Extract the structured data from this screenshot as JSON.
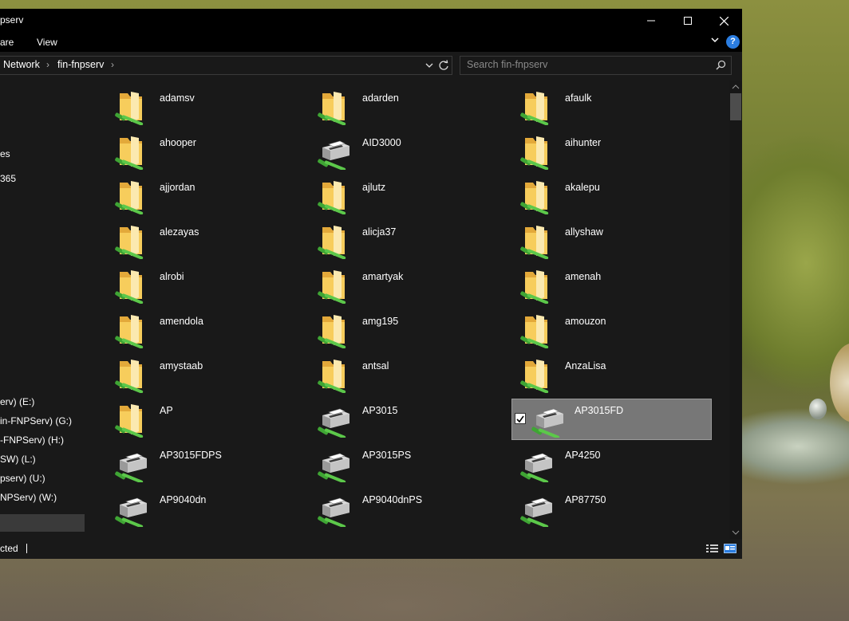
{
  "window": {
    "title": "pserv",
    "ribbon_tabs": [
      "are",
      "View"
    ],
    "help_label": "?"
  },
  "address_bar": {
    "breadcrumbs": [
      "Network",
      "fin-fnpserv"
    ],
    "separator": "›"
  },
  "search": {
    "placeholder": "Search fin-fnpserv"
  },
  "nav_pane": {
    "items": [
      "es",
      "365",
      "erv) (E:)",
      "in-FNPServ) (G:)",
      "-FNPServ) (H:)",
      "SW) (L:)",
      "pserv) (U:)",
      "NPServ) (W:)"
    ]
  },
  "items": [
    {
      "name": "adamsv",
      "type": "folder"
    },
    {
      "name": "adarden",
      "type": "folder"
    },
    {
      "name": "afaulk",
      "type": "folder"
    },
    {
      "name": "ahooper",
      "type": "folder"
    },
    {
      "name": "AID3000",
      "type": "printer"
    },
    {
      "name": "aihunter",
      "type": "folder"
    },
    {
      "name": "ajjordan",
      "type": "folder"
    },
    {
      "name": "ajlutz",
      "type": "folder"
    },
    {
      "name": "akalepu",
      "type": "folder"
    },
    {
      "name": "alezayas",
      "type": "folder"
    },
    {
      "name": "alicja37",
      "type": "folder"
    },
    {
      "name": "allyshaw",
      "type": "folder"
    },
    {
      "name": "alrobi",
      "type": "folder"
    },
    {
      "name": "amartyak",
      "type": "folder"
    },
    {
      "name": "amenah",
      "type": "folder"
    },
    {
      "name": "amendola",
      "type": "folder"
    },
    {
      "name": "amg195",
      "type": "folder"
    },
    {
      "name": "amouzon",
      "type": "folder"
    },
    {
      "name": "amystaab",
      "type": "folder"
    },
    {
      "name": "antsal",
      "type": "folder"
    },
    {
      "name": "AnzaLisa",
      "type": "folder"
    },
    {
      "name": "AP",
      "type": "folder"
    },
    {
      "name": "AP3015",
      "type": "printer"
    },
    {
      "name": "AP3015FD",
      "type": "printer",
      "selected": true
    },
    {
      "name": "AP3015FDPS",
      "type": "printer"
    },
    {
      "name": "AP3015PS",
      "type": "printer"
    },
    {
      "name": "AP4250",
      "type": "printer"
    },
    {
      "name": "AP9040dn",
      "type": "printer"
    },
    {
      "name": "AP9040dnPS",
      "type": "printer"
    },
    {
      "name": "AP87750",
      "type": "printer"
    }
  ],
  "status_bar": {
    "text": "cted"
  },
  "colors": {
    "accent": "#2b7de0",
    "share_link": "#39b54a",
    "folder": "#f5c84c",
    "selected_bg": "#777777"
  }
}
